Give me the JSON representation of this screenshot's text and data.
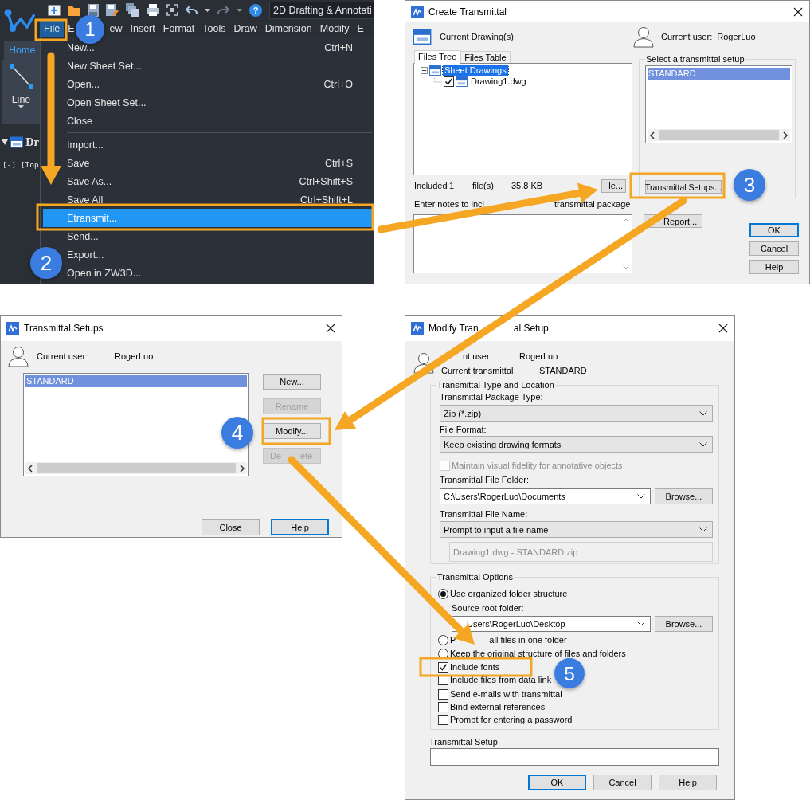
{
  "app_window": {
    "quick_access": {
      "help": "?",
      "workspace": "2D Drafting & Annotati"
    },
    "menu_bar": [
      {
        "label": "File",
        "selected": true
      },
      {
        "label": "E",
        "selected": false
      },
      {
        "label": "ew",
        "selected": false
      },
      {
        "label": "Insert",
        "selected": false
      },
      {
        "label": "Format",
        "selected": false
      },
      {
        "label": "Tools",
        "selected": false
      },
      {
        "label": "Draw",
        "selected": false
      },
      {
        "label": "Dimension",
        "selected": false
      },
      {
        "label": "Modify",
        "selected": false
      },
      {
        "label": "E",
        "selected": false
      }
    ],
    "ribbon": {
      "tab": "Home",
      "tool": "Line"
    },
    "document_tab": "Dr",
    "viewport_label": "[-] [Top",
    "file_menu": [
      [
        {
          "label": "New...",
          "shortcut": "Ctrl+N",
          "selected": false
        },
        {
          "label": "New Sheet Set...",
          "selected": false
        },
        {
          "label": "Open...",
          "shortcut": "Ctrl+O",
          "selected": false
        },
        {
          "label": "Open Sheet Set...",
          "selected": false
        },
        {
          "label": "Close",
          "selected": false
        }
      ],
      [
        {
          "label": "Import...",
          "selected": false
        },
        {
          "label": "Save",
          "shortcut": "Ctrl+S",
          "selected": false
        },
        {
          "label": "Save As...",
          "shortcut": "Ctrl+Shift+S",
          "selected": false
        },
        {
          "label": "Save All",
          "shortcut": "Ctrl+Shift+L",
          "selected": false
        },
        {
          "label": "Etransmit...",
          "selected": true
        },
        {
          "label": "Send...",
          "selected": false
        },
        {
          "label": "Export...",
          "selected": false
        },
        {
          "label": "Open in ZW3D...",
          "selected": false
        }
      ]
    ]
  },
  "create_transmittal": {
    "title": "Create Transmittal",
    "drawings_label": "Current Drawing(s):",
    "user_label": "Current user:",
    "user": "RogerLuo",
    "tabs": [
      {
        "label": "Files Tree",
        "selected": true
      },
      {
        "label": "Files Table",
        "selected": false
      }
    ],
    "tree": [
      {
        "label": "Sheet Drawings",
        "selected": true,
        "expanded": true,
        "children": [
          {
            "label": "Drawing1.dwg",
            "selected": false,
            "checked": true
          }
        ]
      }
    ],
    "setup_label": "Select a transmittal setup",
    "setups": [
      {
        "label": "STANDARD",
        "selected": true
      }
    ],
    "summary": [
      "Included",
      "1",
      "file(s)",
      "35.8 KB"
    ],
    "add_file_button": "le...",
    "setups_button": "Transmittal Setups...",
    "notes_label": [
      "Enter notes to incl",
      "transmittal package"
    ],
    "report_button": "Report...",
    "buttons": [
      {
        "label": "OK",
        "default": true
      },
      {
        "label": "Cancel",
        "default": false
      },
      {
        "label": "Help",
        "default": false
      }
    ]
  },
  "transmittal_setups": {
    "title": "Transmittal Setups",
    "user_label": "Current user:",
    "user": "RogerLuo",
    "setups": [
      {
        "label": "STANDARD",
        "selected": true
      }
    ],
    "side_buttons": [
      {
        "parts": [
          "New..."
        ],
        "disabled": false
      },
      {
        "parts": [
          "Rename"
        ],
        "disabled": true
      },
      {
        "parts": [
          "Modify..."
        ],
        "disabled": false
      },
      {
        "parts": [
          "De",
          "ete"
        ],
        "disabled": true
      }
    ],
    "buttons": [
      {
        "label": "Close",
        "default": false
      },
      {
        "label": "Help",
        "default": true
      }
    ]
  },
  "modify_setup": {
    "title_parts": [
      "Modify Tran",
      "al Setup"
    ],
    "user_label": "nt user:",
    "user": "RogerLuo",
    "transmittal_label": "Current transmittal",
    "transmittal": "STANDARD",
    "type_location": {
      "title": "Transmittal Type and Location",
      "package_type_label": "Transmittal Package Type:",
      "package_type": "Zip (*.zip)",
      "file_format_label": "File Format:",
      "file_format": "Keep existing drawing formats",
      "fidelity": {
        "label": "Maintain visual fidelity for annotative objects",
        "checked": false,
        "disabled": true
      },
      "folder_label": "Transmittal File Folder:",
      "folder": "C:\\Users\\RogerLuo\\Documents",
      "folder_browse": "Browse...",
      "name_label": "Transmittal File Name:",
      "name": "Prompt to input a file name",
      "file_name": "Drawing1.dwg - STANDARD.zip"
    },
    "options": {
      "title": "Transmittal Options",
      "source_label": "Source root folder:",
      "source": "Users\\RogerLuo\\Desktop",
      "source_browse": "Browse...",
      "folder_structure": [
        {
          "parts": [
            "Use organized folder structure"
          ],
          "selected": true
        },
        {
          "parts": [
            "P",
            "all files in one folder"
          ],
          "selected": false
        },
        {
          "parts": [
            "Keep the original structure of files and folders"
          ],
          "selected": false
        }
      ],
      "checks": [
        {
          "label": "Include fonts",
          "checked": true
        },
        {
          "label": "Include files from data link",
          "checked": false
        },
        {
          "label": "Send e-mails with transmittal",
          "checked": false
        },
        {
          "label": "Bind external references",
          "checked": false
        },
        {
          "label": "Prompt for entering a password",
          "checked": false
        }
      ]
    },
    "setup_label": "Transmittal Setup",
    "buttons": [
      {
        "label": "OK",
        "default": true
      },
      {
        "label": "Cancel",
        "default": false
      },
      {
        "label": "Help",
        "default": false
      }
    ]
  },
  "step_badges": [
    "1",
    "2",
    "3",
    "4",
    "5"
  ]
}
